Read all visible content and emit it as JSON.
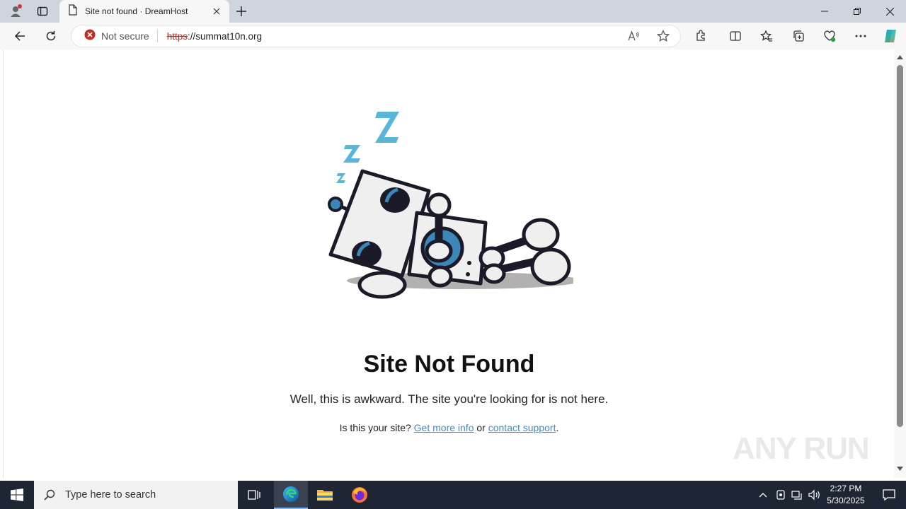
{
  "browser": {
    "tab": {
      "title": "Site not found · DreamHost"
    },
    "security": {
      "label": "Not secure"
    },
    "url": {
      "scheme": "https",
      "rest": "://summat10n.org"
    }
  },
  "page": {
    "heading": "Site Not Found",
    "message": "Well, this is awkward. The site you're looking for is not here.",
    "prompt": "Is this your site?",
    "link_more": "Get more info",
    "or_text": "or",
    "link_support": "contact support",
    "period": ".",
    "watermark": "ANY RUN"
  },
  "taskbar": {
    "search_placeholder": "Type here to search",
    "time": "2:27 PM",
    "date": "5/30/2025"
  }
}
